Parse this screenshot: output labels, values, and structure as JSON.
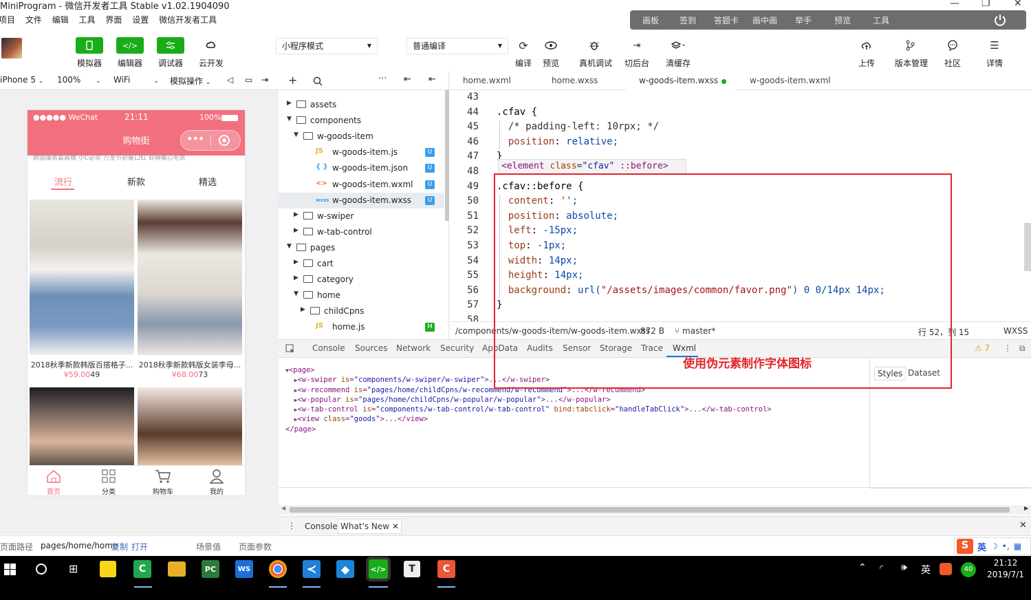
{
  "window": {
    "title": "MiniProgram - 微信开发者工具 Stable v1.02.1904090",
    "minimize": "—",
    "restore": "❐",
    "close": "✕"
  },
  "menu": [
    "项目",
    "文件",
    "编辑",
    "工具",
    "界面",
    "设置",
    "微信开发者工具"
  ],
  "float_toolbar": {
    "items": [
      "画板",
      "签到",
      "答题卡",
      "画中画",
      "举手",
      "预览",
      "工具"
    ],
    "power_icon": "power-icon"
  },
  "toolbar": {
    "buttons": [
      {
        "label": "模拟器",
        "icon": "phone-icon"
      },
      {
        "label": "编辑器",
        "icon": "code-icon"
      },
      {
        "label": "调试器",
        "icon": "debug-icon"
      },
      {
        "label": "云开发",
        "icon": "cloud-dev-icon"
      }
    ],
    "mode_select": "小程序模式",
    "compile_select": "普通编译",
    "actions": [
      {
        "label": "编译",
        "icon": "refresh-icon"
      },
      {
        "label": "预览",
        "icon": "eye-icon"
      },
      {
        "label": "真机调试",
        "icon": "bug-icon"
      },
      {
        "label": "切后台",
        "icon": "switch-icon"
      },
      {
        "label": "清缓存",
        "icon": "layers-icon"
      }
    ],
    "right_actions": [
      {
        "label": "上传",
        "icon": "upload-icon"
      },
      {
        "label": "版本管理",
        "icon": "branch-icon"
      },
      {
        "label": "社区",
        "icon": "chat-icon"
      },
      {
        "label": "详情",
        "icon": "menu-icon"
      }
    ]
  },
  "simulator_bar": {
    "device": "iPhone 5",
    "zoom": "100%",
    "network": "WiFi",
    "sim_ops": "模拟操作"
  },
  "phone": {
    "carrier": "●●●●● WeChat",
    "time": "21:11",
    "battery": "100%",
    "nav_title": "购物街",
    "faded_recommend": "颜值爆表套装裙    小C必杀    万圣节必备口红    软萌暖心毛衣",
    "tabs": [
      "流行",
      "新款",
      "精选"
    ],
    "goods": [
      {
        "title": "2018秋季新款韩版百搭格子...",
        "price": "¥59.00",
        "cfav": "49"
      },
      {
        "title": "2018秋季新款韩版女装李母...",
        "price": "¥68.00",
        "cfav": "73"
      },
      {
        "title": "",
        "price": "",
        "cfav": ""
      },
      {
        "title": "",
        "price": "",
        "cfav": ""
      }
    ],
    "tabbar": [
      "首页",
      "分类",
      "购物车",
      "我的"
    ]
  },
  "filetree": {
    "items": [
      {
        "label": "assets",
        "type": "folder",
        "level": 0,
        "open": false
      },
      {
        "label": "components",
        "type": "folder",
        "level": 0,
        "open": true
      },
      {
        "label": "w-goods-item",
        "type": "folder",
        "level": 1,
        "open": true
      },
      {
        "label": "w-goods-item.js",
        "type": "js",
        "level": 2,
        "badge": "U"
      },
      {
        "label": "w-goods-item.json",
        "type": "json",
        "level": 2,
        "badge": "U"
      },
      {
        "label": "w-goods-item.wxml",
        "type": "wxml",
        "level": 2,
        "badge": "U"
      },
      {
        "label": "w-goods-item.wxss",
        "type": "wxss",
        "level": 2,
        "badge": "U"
      },
      {
        "label": "w-swiper",
        "type": "folder",
        "level": 1,
        "open": false
      },
      {
        "label": "w-tab-control",
        "type": "folder",
        "level": 1,
        "open": false
      },
      {
        "label": "pages",
        "type": "folder",
        "level": 0,
        "open": true
      },
      {
        "label": "cart",
        "type": "folder",
        "level": 1,
        "open": false
      },
      {
        "label": "category",
        "type": "folder",
        "level": 1,
        "open": false
      },
      {
        "label": "home",
        "type": "folder",
        "level": 1,
        "open": true
      },
      {
        "label": "childCpns",
        "type": "folder",
        "level": 2,
        "open": false
      },
      {
        "label": "home.js",
        "type": "js",
        "level": 2,
        "badge": "M"
      }
    ]
  },
  "editor": {
    "tabs": [
      "home.wxml",
      "home.wxss",
      "w-goods-item.wxss",
      "w-goods-item.wxml"
    ],
    "active_tab": "w-goods-item.wxss",
    "inline_hint": "<element class=\"cfav\" ::before>",
    "line_numbers": [
      "43",
      "44",
      "45",
      "46",
      "47",
      "48",
      "49",
      "50",
      "51",
      "52",
      "53",
      "54",
      "55",
      "56",
      "57",
      "58"
    ],
    "lines": [
      "",
      ".cfav {",
      "  /* padding-left: 10rpx; */",
      "  position: relative;",
      "}",
      "",
      ".cfav::before {",
      "  content: '';",
      "  position: absolute;",
      "  left: -15px;",
      "  top: -1px;",
      "  width: 14px;",
      "  height: 14px;",
      "  background: url(\"/assets/images/common/favor.png\") 0 0/14px 14px;",
      "}",
      ""
    ],
    "status": {
      "path": "/components/w-goods-item/w-goods-item.wxss",
      "size": "872 B",
      "branch": "master*",
      "cursor": "行 52，列 15",
      "lang": "WXSS"
    }
  },
  "devtools": {
    "tabs": [
      "Console",
      "Sources",
      "Network",
      "Security",
      "AppData",
      "Audits",
      "Sensor",
      "Storage",
      "Trace",
      "Wxml"
    ],
    "active_tab": "Wxml",
    "warnings": "⚠ 7",
    "tree": [
      "▼<page>",
      "  ▶<w-swiper is=\"components/w-swiper/w-swiper\">...</w-swiper>",
      "  ▶<w-recommend is=\"pages/home/childCpns/w-recommend/w-recommend\">...</w-recommend>",
      "  ▶<w-popular is=\"pages/home/childCpns/w-popular/w-popular\">...</w-popular>",
      "  ▶<w-tab-control is=\"components/w-tab-control/w-tab-control\" bind:tabclick=\"handleTabClick\">...</w-tab-control>",
      "  ▶<view class=\"goods\">...</view>",
      "</page>"
    ],
    "side_tabs": [
      "Styles",
      "Dataset"
    ],
    "drawer_tabs": [
      "Console",
      "What's New"
    ]
  },
  "annotation": "使用伪元素制作字体图标",
  "bottombar": {
    "path_label": "页面路径",
    "path": "pages/home/home",
    "copy": "复制",
    "open": "打开",
    "scene": "场景值",
    "params": "页面参数"
  },
  "taskbar": {
    "time": "21:12",
    "date": "2019/7/1",
    "ime": "英",
    "tray_badge": "40",
    "apps": [
      "windows-icon",
      "search-icon",
      "task-view-icon",
      "sticky-notes-icon",
      "camtasia-icon",
      "file-explorer-icon",
      "pycharm-icon",
      "wps-icon",
      "chrome-icon",
      "vscode-icon",
      "app-icon",
      "wechat-devtools-icon",
      "typora-icon",
      "recorder-icon"
    ]
  },
  "colors": {
    "accent_green": "#1aad19",
    "phone_pink": "#f2707e",
    "annotation_red": "#e3242b",
    "badge_blue": "#3d9eea"
  }
}
